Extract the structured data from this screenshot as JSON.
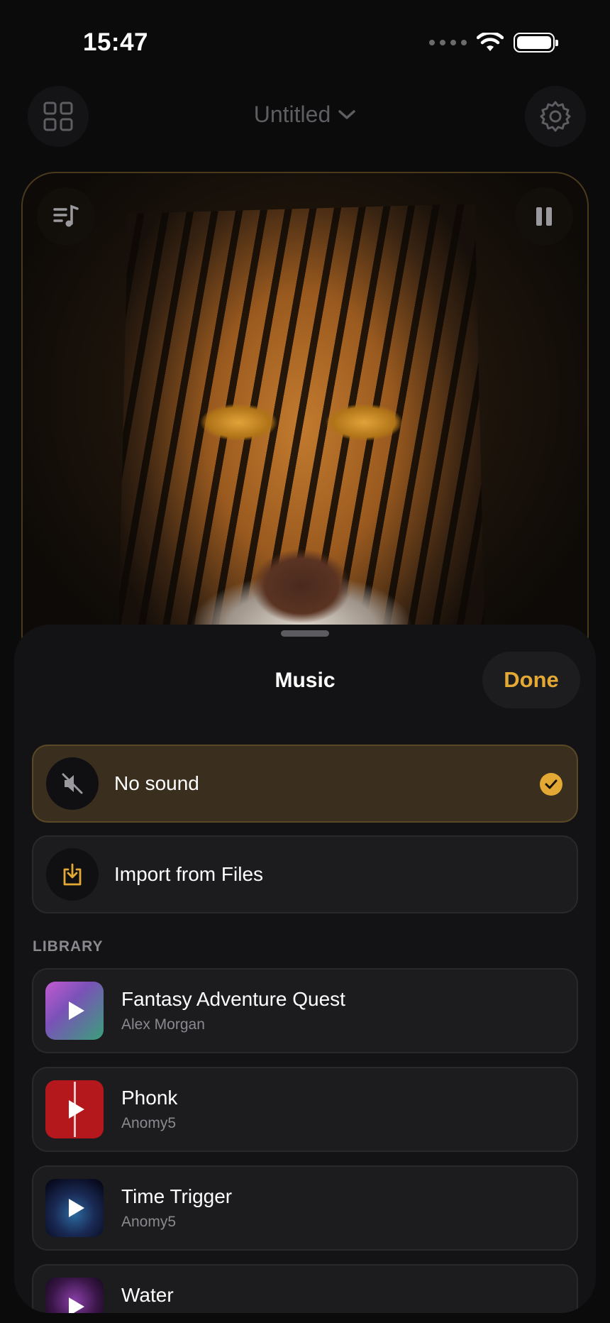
{
  "status_bar": {
    "time": "15:47"
  },
  "header": {
    "title": "Untitled"
  },
  "sheet": {
    "title": "Music",
    "done_label": "Done",
    "no_sound_label": "No sound",
    "import_label": "Import from Files",
    "library_header": "LIBRARY",
    "tracks": [
      {
        "title": "Fantasy Adventure Quest",
        "artist": "Alex Morgan"
      },
      {
        "title": "Phonk",
        "artist": "Anomy5"
      },
      {
        "title": "Time Trigger",
        "artist": "Anomy5"
      },
      {
        "title": "Water",
        "artist": ""
      }
    ]
  },
  "colors": {
    "accent": "#e3a934",
    "selected_bg": "#3a2f1e",
    "sheet_bg": "#131315"
  },
  "icons": [
    "grid-icon",
    "chevron-down-icon",
    "gear-icon",
    "music-list-icon",
    "pause-icon",
    "mute-icon",
    "checkmark-icon",
    "import-icon",
    "play-icon"
  ]
}
